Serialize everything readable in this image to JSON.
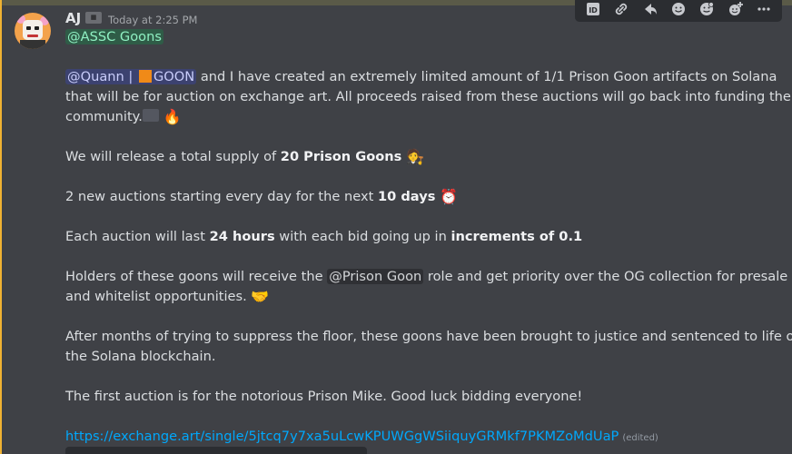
{
  "header": {
    "username": "AJ",
    "timestamp": "Today at 2:25 PM"
  },
  "toolbar": {
    "icons": [
      "id-icon",
      "link-icon",
      "reply-icon",
      "emoji-icon",
      "emoji-2-icon",
      "add-reaction-icon",
      "more-icon"
    ]
  },
  "message": {
    "role_mention": "@ASSC Goons",
    "p1_mention": "@Quann |",
    "p1_mention_b": "GOON",
    "p1_rest": "and I have created an extremely limited amount of 1/1 Prison Goon artifacts on Solana",
    "p1_line2": "that will be for auction on exchange art. All proceeds raised from these auctions will go back into funding the",
    "p1_line3": "community.",
    "p2_pre": "We will release a total supply of ",
    "p2_bold": "20 Prison Goons",
    "p3_pre": "2 new auctions starting every day for the next ",
    "p3_bold": "10 days",
    "p4_pre": "Each auction will last ",
    "p4_bold1": "24 hours",
    "p4_mid": " with each bid going up in ",
    "p4_bold2": "increments of 0.1",
    "p5_pre": "Holders of these goons will receive the ",
    "p5_role": "@Prison Goon",
    "p5_post": " role and get priority over the OG collection for presale",
    "p5_line2": "and whitelist opportunities.",
    "p6_line1": "After months of trying to suppress the floor, these goons have been brought to justice and sentenced to life on",
    "p6_line2": "the Solana blockchain.",
    "p7": "The first auction is for the notorious Prison Mike. Good luck bidding everyone!",
    "link": "https://exchange.art/single/5jtcq7y7xa5uLcwKPUWGgWSiiquyGRMkf7PKMZoMdUaP",
    "edited": "(edited)",
    "emoji_fire": "🔥",
    "emoji_person": "🧑‍⚖️",
    "emoji_clock": "⏰",
    "emoji_handshake": "🤝"
  },
  "colors": {
    "accent_bar": "#f0b232",
    "mention_bg": "#3c4270",
    "link": "#00a8fc"
  }
}
